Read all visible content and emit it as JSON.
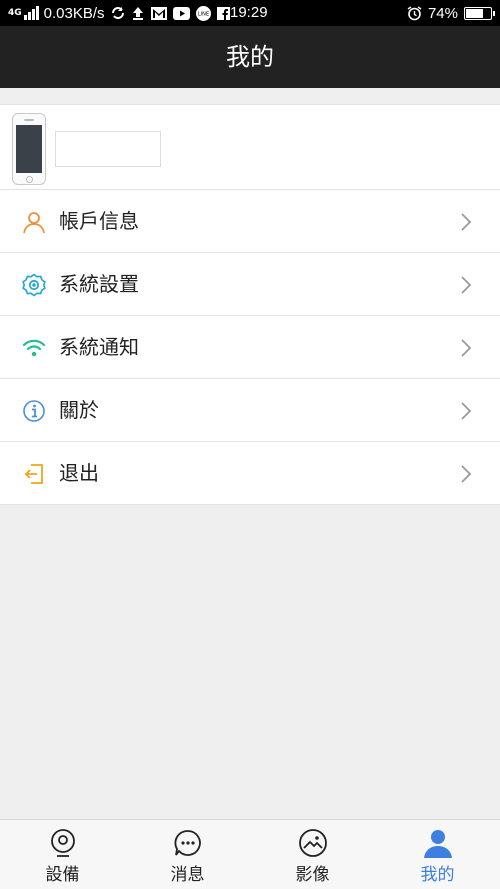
{
  "status_bar": {
    "network_type": "4G",
    "speed": "0.03KB/s",
    "time": "19:29",
    "battery_percent": "74%",
    "battery_level": 0.74,
    "icons": [
      "signal-icon",
      "sync-icon",
      "upload-icon",
      "gmail-icon",
      "youtube-icon",
      "line-icon",
      "facebook-icon",
      "alarm-icon",
      "battery-icon"
    ]
  },
  "header": {
    "title": "我的"
  },
  "device": {
    "name": ""
  },
  "menu": [
    {
      "label": "帳戶信息",
      "icon": "user-icon",
      "color": "#f0913a"
    },
    {
      "label": "系統設置",
      "icon": "gear-icon",
      "color": "#2aa7d9"
    },
    {
      "label": "系統通知",
      "icon": "wifi-icon",
      "color": "#21c08a"
    },
    {
      "label": "關於",
      "icon": "info-icon",
      "color": "#4a90d9"
    },
    {
      "label": "退出",
      "icon": "logout-icon",
      "color": "#f2a516"
    }
  ],
  "bottom_nav": [
    {
      "label": "設備",
      "icon": "device-icon",
      "active": false
    },
    {
      "label": "消息",
      "icon": "message-icon",
      "active": false
    },
    {
      "label": "影像",
      "icon": "image-icon",
      "active": false
    },
    {
      "label": "我的",
      "icon": "profile-icon",
      "active": true
    }
  ],
  "colors": {
    "header_bg": "#222222",
    "active_tab": "#3f7fe0",
    "background": "#efefef"
  }
}
